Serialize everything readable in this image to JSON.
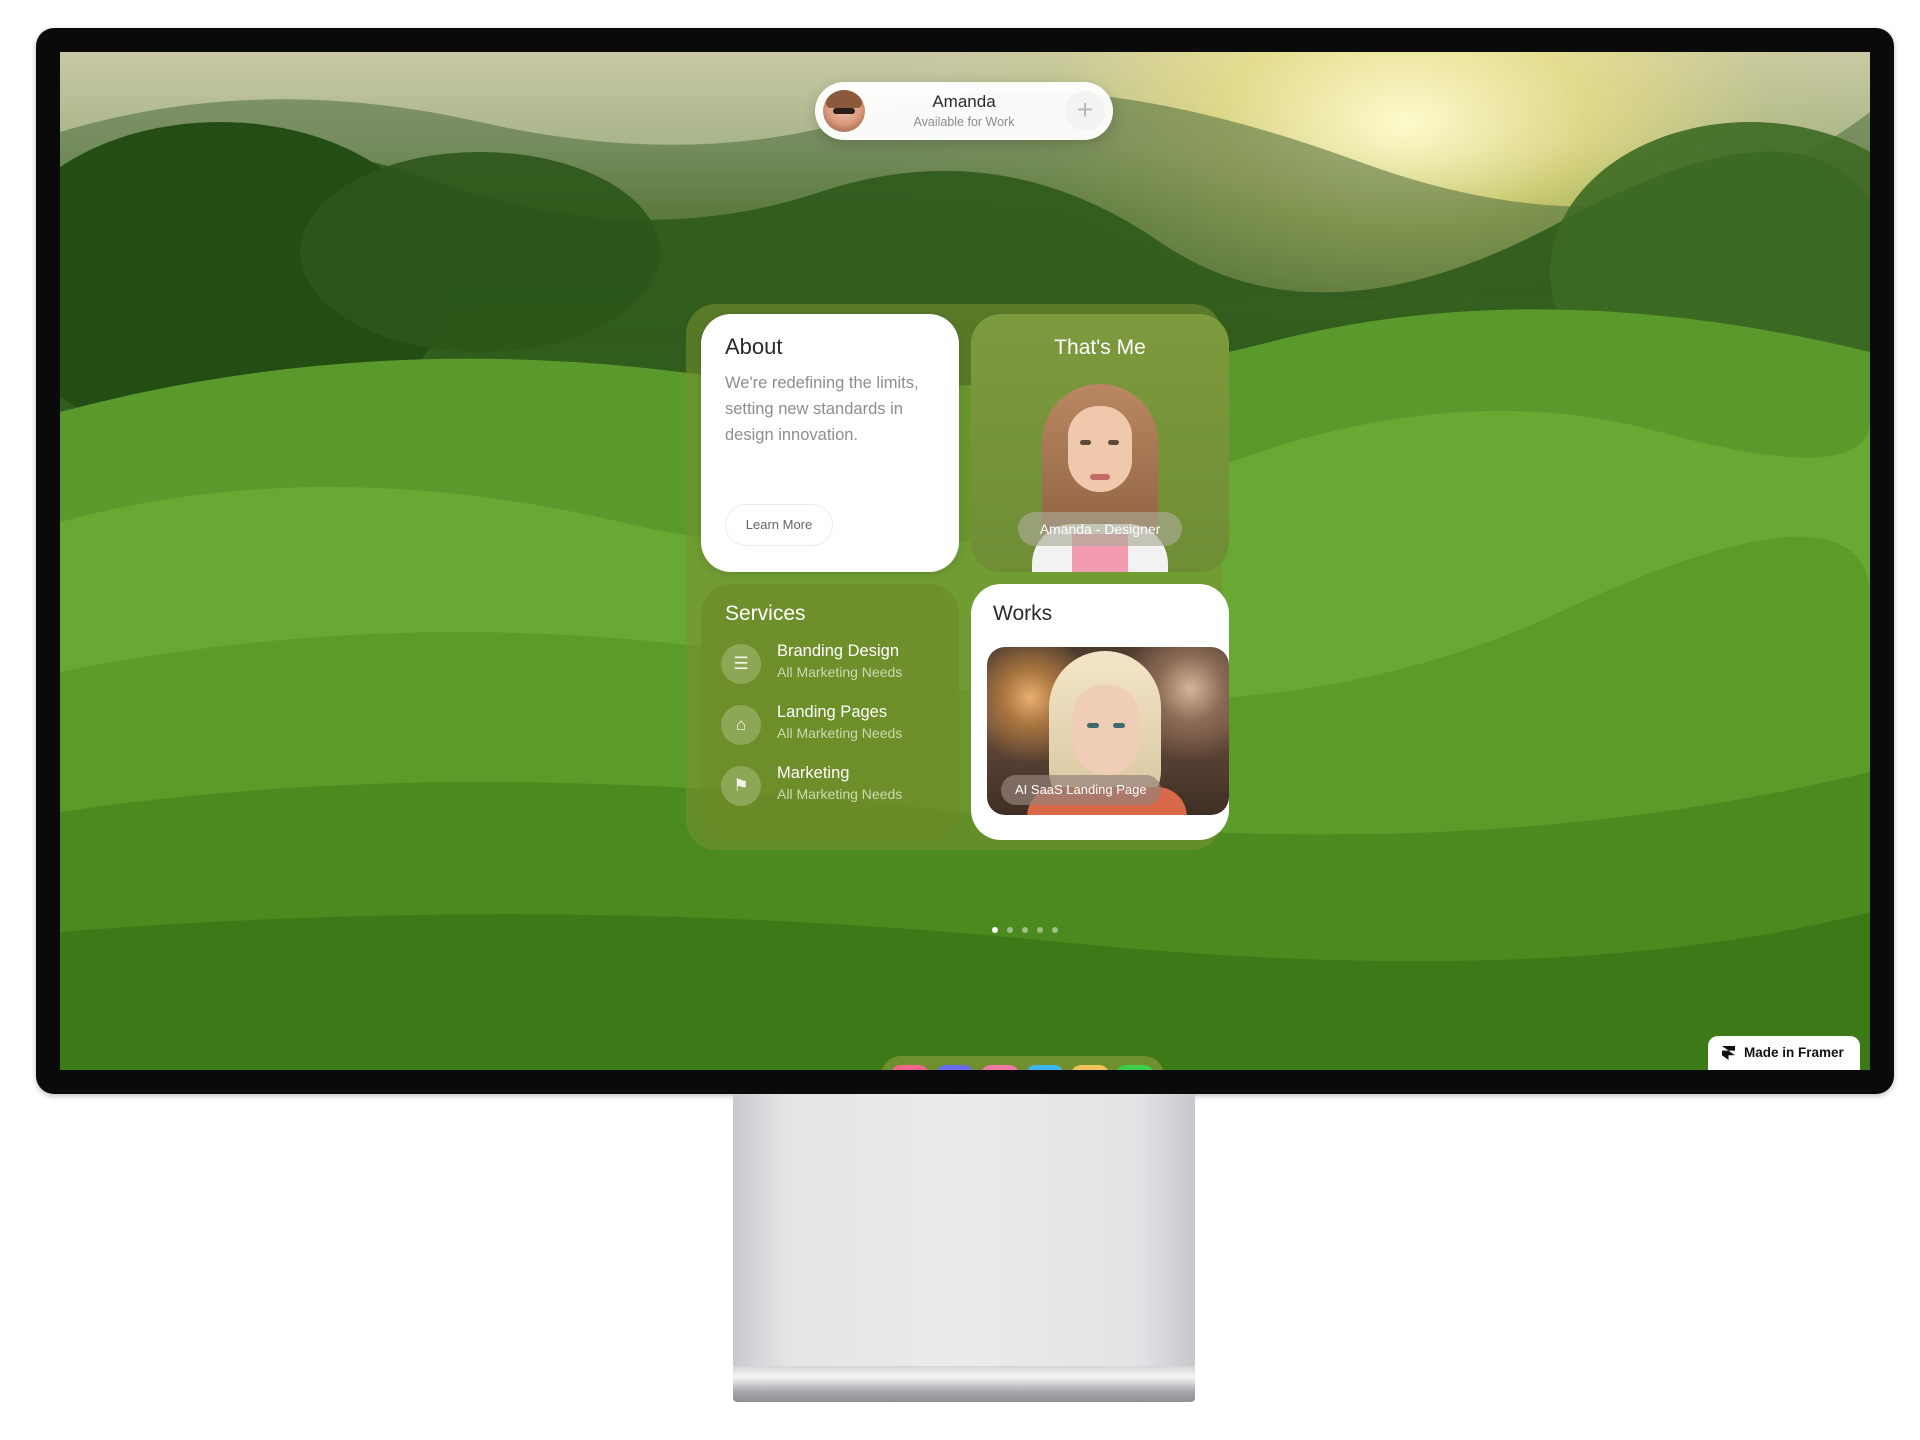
{
  "profile": {
    "name": "Amanda",
    "status": "Available for Work",
    "plus_icon": "plus-icon",
    "plus_glyph": "+"
  },
  "about": {
    "title": "About",
    "text": "We're redefining the limits, setting new standards in design innovation.",
    "button": "Learn More"
  },
  "thats_me": {
    "title": "That's Me",
    "badge": "Amanda - Designer"
  },
  "services": {
    "title": "Services",
    "items": [
      {
        "name": "Branding Design",
        "sub": "All Marketing Needs",
        "icon": "database-icon",
        "glyph": "☰"
      },
      {
        "name": "Landing Pages",
        "sub": "All Marketing Needs",
        "icon": "gift-icon",
        "glyph": "⌂"
      },
      {
        "name": "Marketing",
        "sub": "All Marketing Needs",
        "icon": "signpost-icon",
        "glyph": "⚑"
      }
    ]
  },
  "works": {
    "title": "Works",
    "badge": "AI SaaS Landing Page"
  },
  "pager": {
    "count": 5,
    "active": 1
  },
  "dock": {
    "apps": [
      {
        "icon": "home-icon",
        "glyph": "⌂",
        "color": "#f0668c"
      },
      {
        "icon": "framer-icon",
        "glyph": "⧩",
        "color": "#6b6ef0"
      },
      {
        "icon": "dribbble-icon",
        "glyph": "◎",
        "color": "#f07aa6"
      },
      {
        "icon": "window-icon",
        "glyph": "▭",
        "color": "#3bb6f2"
      },
      {
        "icon": "book-icon",
        "glyph": "▯",
        "color": "#f2c25a"
      },
      {
        "icon": "mail-icon",
        "glyph": "✉",
        "color": "#3ccf4a"
      }
    ]
  },
  "framer_badge": "Made in Framer"
}
